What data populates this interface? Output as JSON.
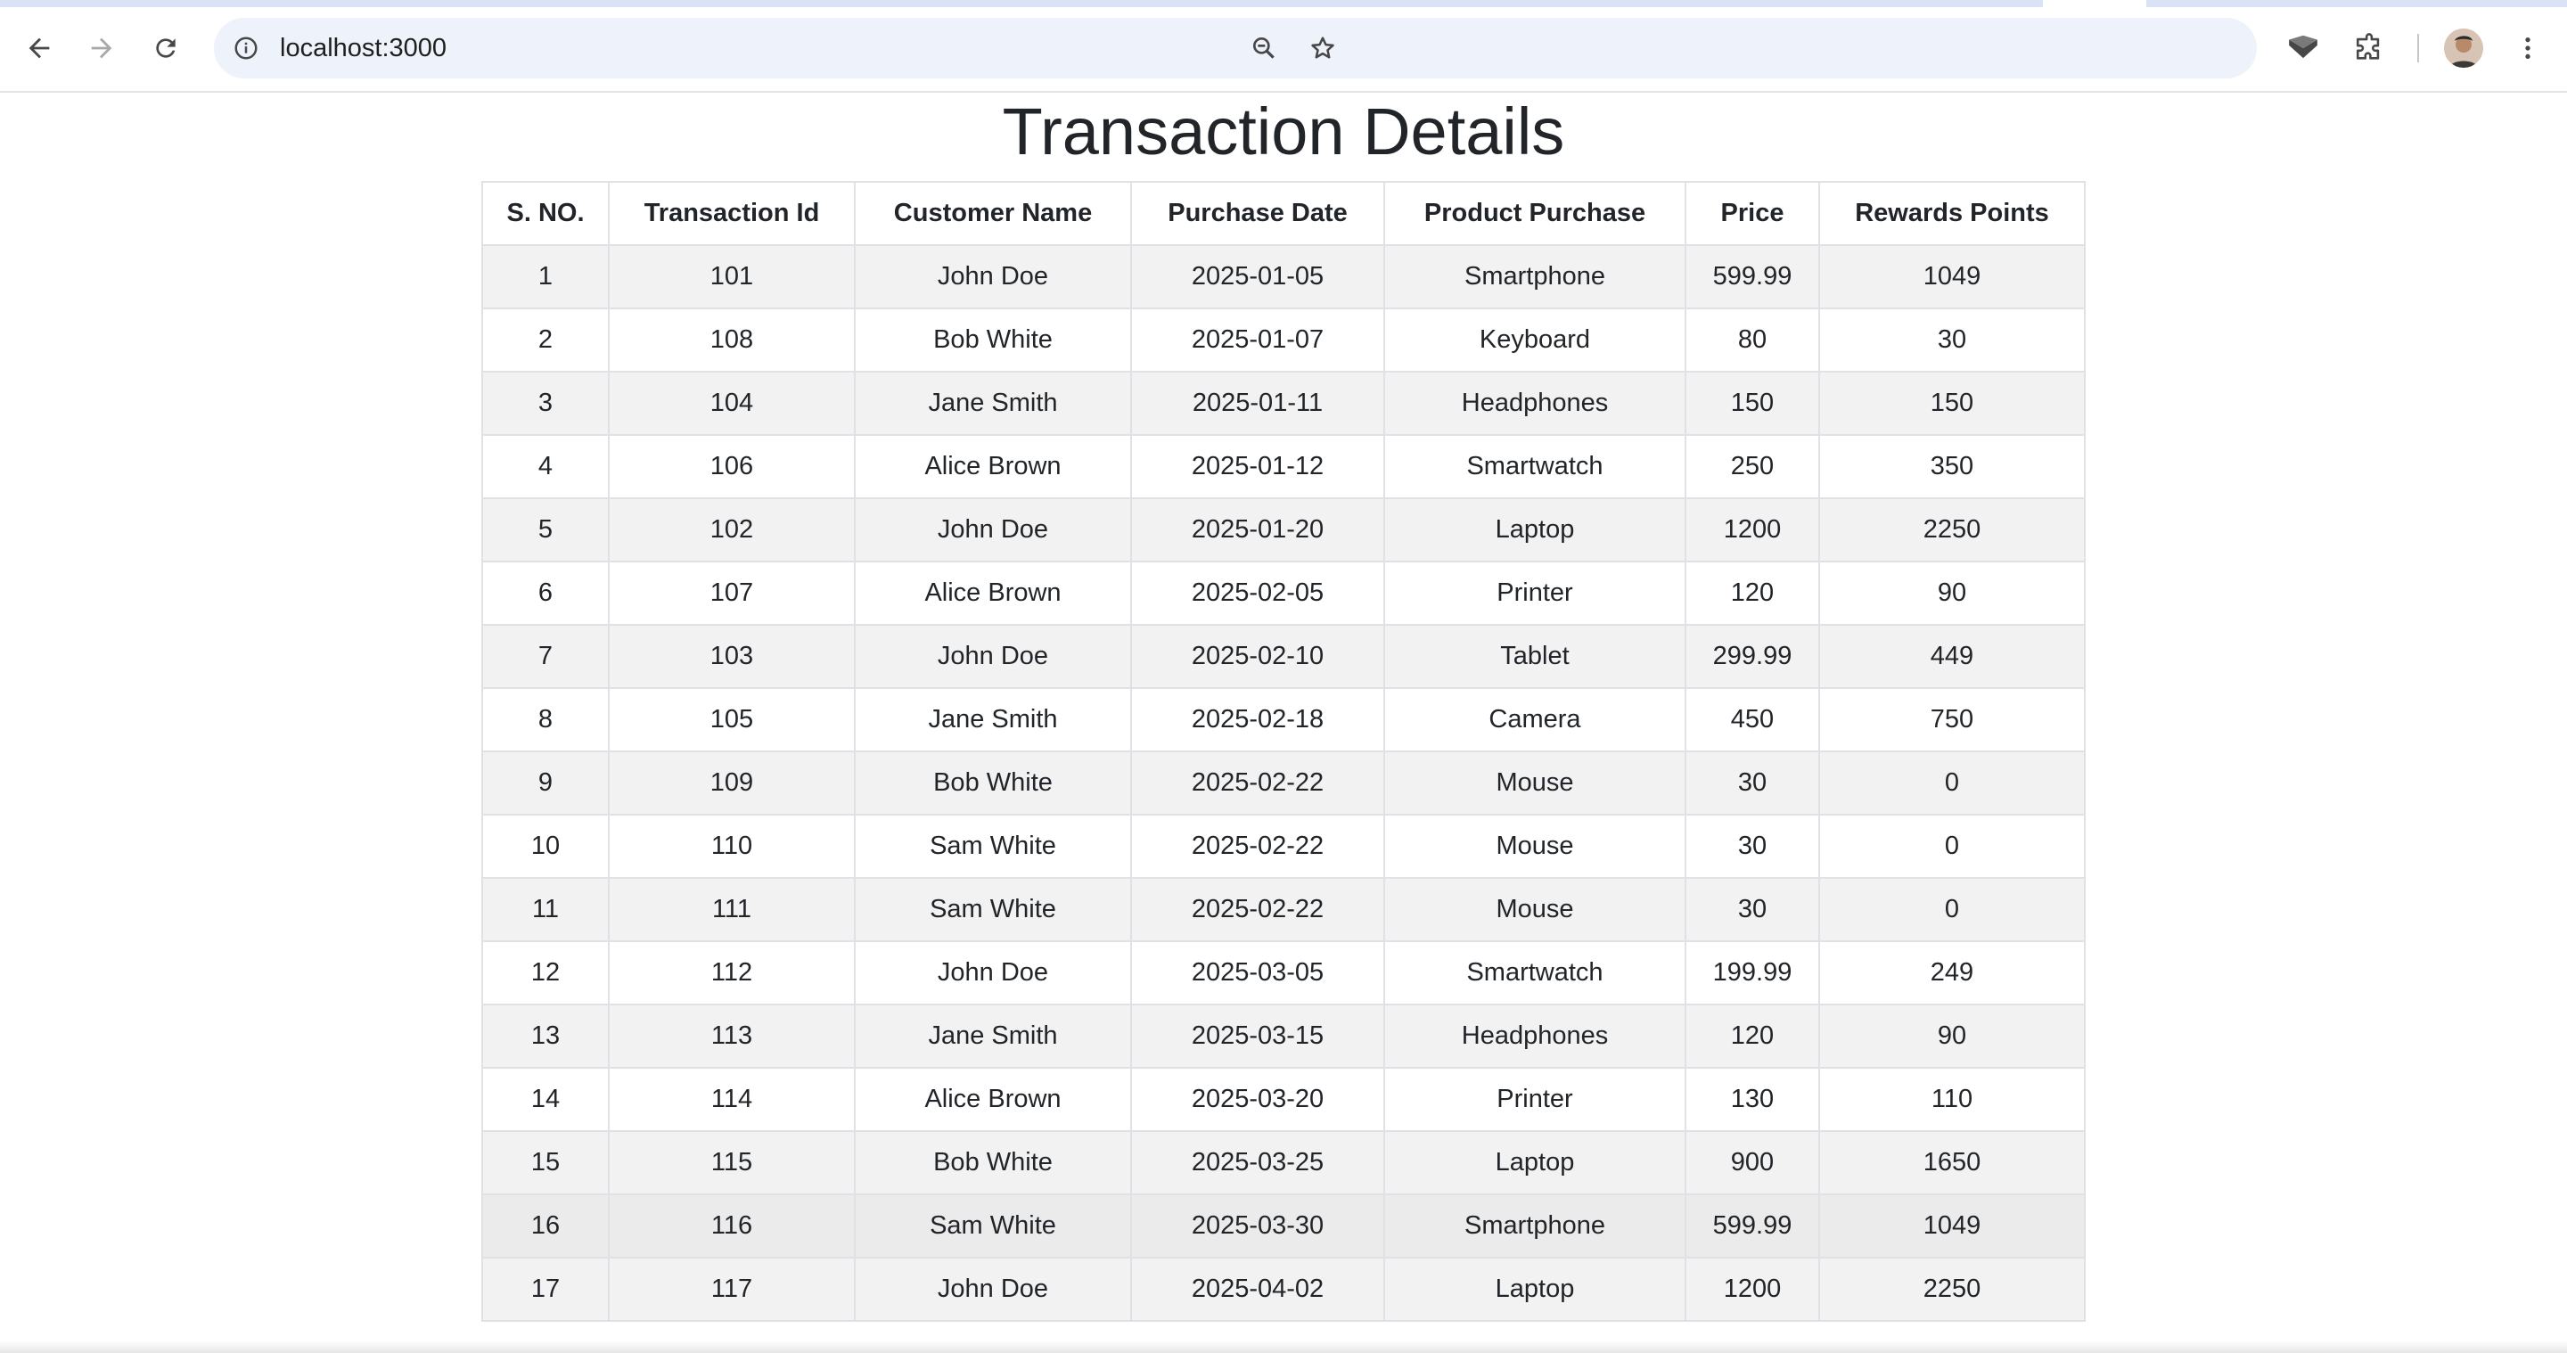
{
  "browser": {
    "url": "localhost:3000",
    "back_label": "Back",
    "forward_label": "Forward",
    "reload_label": "Reload"
  },
  "page": {
    "title": "Transaction Details"
  },
  "table": {
    "headers": {
      "sno": "S. NO.",
      "transaction_id": "Transaction Id",
      "customer_name": "Customer Name",
      "purchase_date": "Purchase Date",
      "product": "Product Purchase",
      "price": "Price",
      "rewards": "Rewards Points"
    },
    "rows": [
      {
        "sno": "1",
        "transaction_id": "101",
        "customer_name": "John Doe",
        "purchase_date": "2025-01-05",
        "product": "Smartphone",
        "price": "599.99",
        "rewards": "1049"
      },
      {
        "sno": "2",
        "transaction_id": "108",
        "customer_name": "Bob White",
        "purchase_date": "2025-01-07",
        "product": "Keyboard",
        "price": "80",
        "rewards": "30"
      },
      {
        "sno": "3",
        "transaction_id": "104",
        "customer_name": "Jane Smith",
        "purchase_date": "2025-01-11",
        "product": "Headphones",
        "price": "150",
        "rewards": "150"
      },
      {
        "sno": "4",
        "transaction_id": "106",
        "customer_name": "Alice Brown",
        "purchase_date": "2025-01-12",
        "product": "Smartwatch",
        "price": "250",
        "rewards": "350"
      },
      {
        "sno": "5",
        "transaction_id": "102",
        "customer_name": "John Doe",
        "purchase_date": "2025-01-20",
        "product": "Laptop",
        "price": "1200",
        "rewards": "2250"
      },
      {
        "sno": "6",
        "transaction_id": "107",
        "customer_name": "Alice Brown",
        "purchase_date": "2025-02-05",
        "product": "Printer",
        "price": "120",
        "rewards": "90"
      },
      {
        "sno": "7",
        "transaction_id": "103",
        "customer_name": "John Doe",
        "purchase_date": "2025-02-10",
        "product": "Tablet",
        "price": "299.99",
        "rewards": "449"
      },
      {
        "sno": "8",
        "transaction_id": "105",
        "customer_name": "Jane Smith",
        "purchase_date": "2025-02-18",
        "product": "Camera",
        "price": "450",
        "rewards": "750"
      },
      {
        "sno": "9",
        "transaction_id": "109",
        "customer_name": "Bob White",
        "purchase_date": "2025-02-22",
        "product": "Mouse",
        "price": "30",
        "rewards": "0"
      },
      {
        "sno": "10",
        "transaction_id": "110",
        "customer_name": "Sam White",
        "purchase_date": "2025-02-22",
        "product": "Mouse",
        "price": "30",
        "rewards": "0"
      },
      {
        "sno": "11",
        "transaction_id": "111",
        "customer_name": "Sam White",
        "purchase_date": "2025-02-22",
        "product": "Mouse",
        "price": "30",
        "rewards": "0"
      },
      {
        "sno": "12",
        "transaction_id": "112",
        "customer_name": "John Doe",
        "purchase_date": "2025-03-05",
        "product": "Smartwatch",
        "price": "199.99",
        "rewards": "249"
      },
      {
        "sno": "13",
        "transaction_id": "113",
        "customer_name": "Jane Smith",
        "purchase_date": "2025-03-15",
        "product": "Headphones",
        "price": "120",
        "rewards": "90"
      },
      {
        "sno": "14",
        "transaction_id": "114",
        "customer_name": "Alice Brown",
        "purchase_date": "2025-03-20",
        "product": "Printer",
        "price": "130",
        "rewards": "110"
      },
      {
        "sno": "15",
        "transaction_id": "115",
        "customer_name": "Bob White",
        "purchase_date": "2025-03-25",
        "product": "Laptop",
        "price": "900",
        "rewards": "1650"
      },
      {
        "sno": "16",
        "transaction_id": "116",
        "customer_name": "Sam White",
        "purchase_date": "2025-03-30",
        "product": "Smartphone",
        "price": "599.99",
        "rewards": "1049"
      },
      {
        "sno": "17",
        "transaction_id": "117",
        "customer_name": "John Doe",
        "purchase_date": "2025-04-02",
        "product": "Laptop",
        "price": "1200",
        "rewards": "2250"
      }
    ]
  },
  "icons": {
    "back": "arrow-left-icon",
    "forward": "arrow-right-icon",
    "reload": "reload-icon",
    "info": "info-icon",
    "zoom": "zoom-out-icon",
    "bookmark": "star-icon",
    "extension_1": "shield-extension-icon",
    "extensions": "puzzle-icon",
    "menu": "kebab-menu-icon"
  },
  "colors": {
    "striped_row": "#f2f2f2",
    "border": "#dee2e6",
    "omnibox": "#eef2fa",
    "text": "#212529"
  }
}
